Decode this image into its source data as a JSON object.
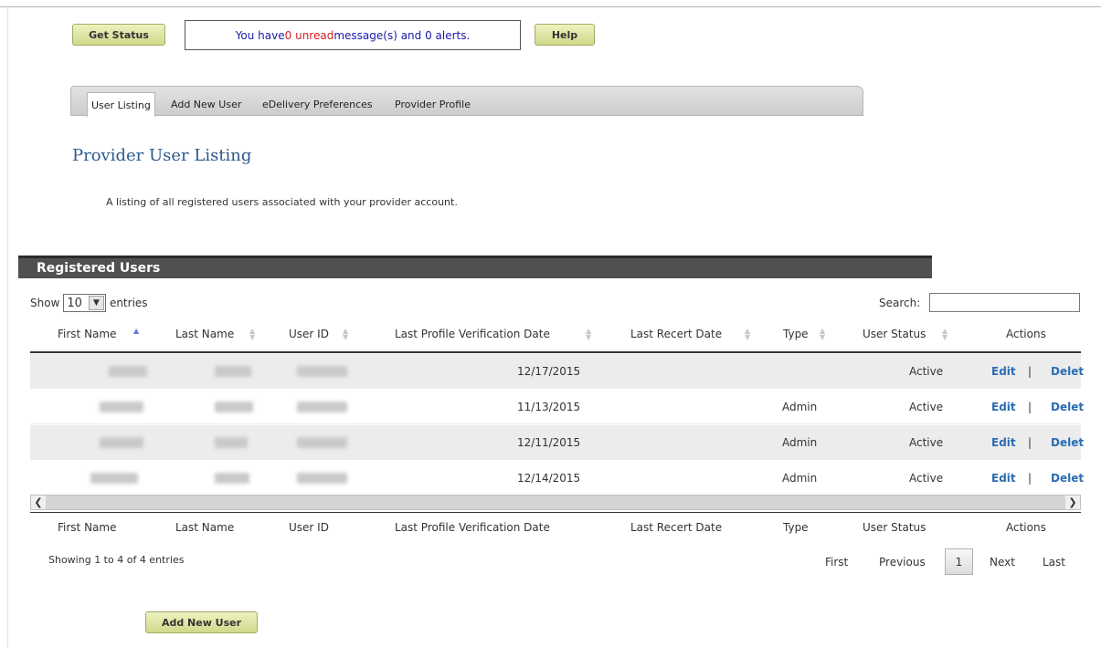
{
  "top": {
    "get_status_label": "Get Status",
    "help_label": "Help",
    "message": {
      "prefix": "You have ",
      "unread_count": "0 unread",
      "suffix": " message(s) and 0 alerts."
    }
  },
  "tabs": [
    {
      "label": "User Listing",
      "active": true
    },
    {
      "label": "Add New User",
      "active": false
    },
    {
      "label": "eDelivery Preferences",
      "active": false
    },
    {
      "label": "Provider Profile",
      "active": false
    }
  ],
  "page": {
    "title": "Provider User Listing",
    "description": "A listing of all registered users associated with your provider account."
  },
  "section": {
    "title": "Registered Users"
  },
  "length_control": {
    "show_label": "Show",
    "value": "10",
    "entries_label": "entries"
  },
  "search": {
    "label": "Search:",
    "value": ""
  },
  "columns": [
    "First Name",
    "Last Name",
    "User ID",
    "Last Profile Verification Date",
    "Last Recert Date",
    "Type",
    "User Status",
    "Actions"
  ],
  "rows": [
    {
      "first_name": "",
      "last_name": "",
      "user_id": "",
      "verification_date": "12/17/2015",
      "recert_date": "",
      "type": "",
      "status": "Active"
    },
    {
      "first_name": "",
      "last_name": "",
      "user_id": "",
      "verification_date": "11/13/2015",
      "recert_date": "",
      "type": "Admin",
      "status": "Active"
    },
    {
      "first_name": "",
      "last_name": "",
      "user_id": "",
      "verification_date": "12/11/2015",
      "recert_date": "",
      "type": "Admin",
      "status": "Active"
    },
    {
      "first_name": "",
      "last_name": "",
      "user_id": "",
      "verification_date": "12/14/2015",
      "recert_date": "",
      "type": "Admin",
      "status": "Active"
    }
  ],
  "actions": {
    "edit": "Edit",
    "separator": "|",
    "delete": "Delet"
  },
  "info": "Showing 1 to 4 of 4 entries",
  "pagination": {
    "first": "First",
    "previous": "Previous",
    "current": "1",
    "next": "Next",
    "last": "Last"
  },
  "bottom": {
    "add_user_label": "Add New User"
  },
  "colors": {
    "accent_link": "#2b6db3",
    "title": "#2c5a8c",
    "header_bar": "#505050",
    "button_olive": "#cfd88a",
    "alert_red": "#d41f1f"
  }
}
